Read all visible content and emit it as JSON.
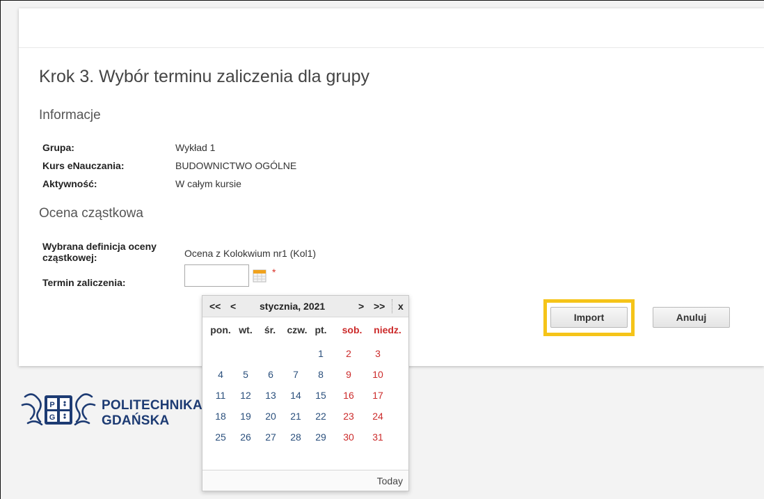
{
  "page": {
    "title": "Krok 3. Wybór terminu zaliczenia dla grupy",
    "sections": {
      "info": "Informacje",
      "partial": "Ocena cząstkowa"
    },
    "info": {
      "group_label": "Grupa:",
      "group_value": "Wykład 1",
      "course_label": "Kurs eNauczania:",
      "course_value": "BUDOWNICTWO OGÓLNE",
      "activity_label": "Aktywność:",
      "activity_value": "W całym kursie"
    },
    "partial": {
      "definition_label_line1": "Wybrana definicja oceny",
      "definition_label_line2": "cząstkowej:",
      "definition_value": "Ocena z Kolokwium nr1 (Kol1)",
      "deadline_label": "Termin zaliczenia:",
      "deadline_value": "",
      "required_marker": "*"
    },
    "buttons": {
      "import": "Import",
      "cancel": "Anuluj"
    }
  },
  "calendar": {
    "prev_year": "<<",
    "prev_month": "<",
    "month_title": "stycznia, 2021",
    "next_month": ">",
    "next_year": ">>",
    "close": "x",
    "day_names": [
      "pon.",
      "wt.",
      "śr.",
      "czw.",
      "pt.",
      "sob.",
      "niedz."
    ],
    "weeks": [
      [
        "",
        "",
        "",
        "",
        "1",
        "2",
        "3"
      ],
      [
        "4",
        "5",
        "6",
        "7",
        "8",
        "9",
        "10"
      ],
      [
        "11",
        "12",
        "13",
        "14",
        "15",
        "16",
        "17"
      ],
      [
        "18",
        "19",
        "20",
        "21",
        "22",
        "23",
        "24"
      ],
      [
        "25",
        "26",
        "27",
        "28",
        "29",
        "30",
        "31"
      ]
    ],
    "today": "Today"
  },
  "logo": {
    "line1": "POLITECHNIKA",
    "line2": "GDAŃSKA"
  },
  "colors": {
    "highlight": "#f5c419",
    "weekend": "#cc2b2b",
    "weekday": "#2a4f7c",
    "logo": "#1d3b73"
  }
}
